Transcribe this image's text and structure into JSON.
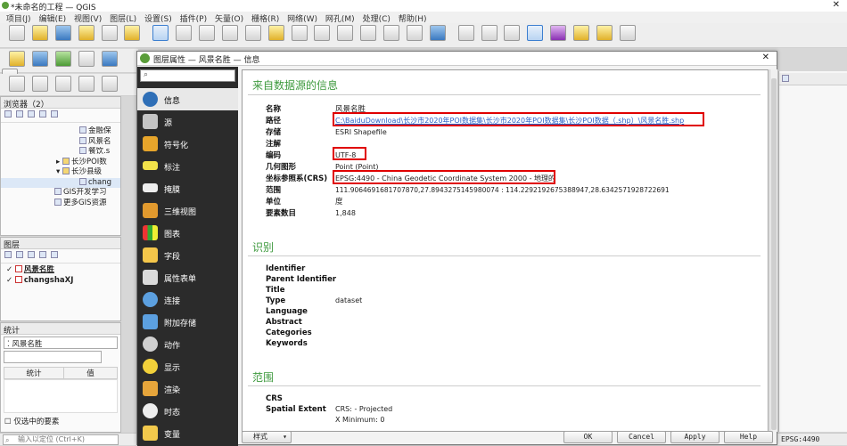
{
  "app": {
    "title": "*未命名的工程 — QGIS",
    "close": "✕"
  },
  "menu": [
    "项目(J)",
    "编辑(E)",
    "视图(V)",
    "图层(L)",
    "设置(S)",
    "插件(P)",
    "矢量(O)",
    "栅格(R)",
    "网络(W)",
    "网孔(M)",
    "处理(C)",
    "帮助(H)"
  ],
  "browser": {
    "title": "浏览器（2）",
    "items": [
      "金融保",
      "风景名",
      "餐饮.s",
      "长沙POI数",
      "长沙县级",
      "chang",
      "GIS开发学习",
      "更多GIS资源"
    ]
  },
  "layers": {
    "title": "图层",
    "items": [
      {
        "name": "风景名胜",
        "checked": "✓"
      },
      {
        "name": "changshaXJ",
        "checked": "✓"
      }
    ]
  },
  "stats": {
    "title": "统计",
    "layer": "风景名胜",
    "col_stat": "统计",
    "col_value": "值",
    "selected_only": "仅选中的要素",
    "locate_placeholder": "输入以定位 (Ctrl+K)"
  },
  "dialog": {
    "title": "图层属性 — 风景名胜 — 信息",
    "close": "✕",
    "nav": [
      "信息",
      "源",
      "符号化",
      "标注",
      "掩膜",
      "三维视图",
      "图表",
      "字段",
      "属性表单",
      "连接",
      "附加存储",
      "动作",
      "显示",
      "渲染",
      "时态",
      "变量"
    ],
    "style_label": "样式",
    "buttons": {
      "ok": "OK",
      "cancel": "Cancel",
      "apply": "Apply",
      "help": "Help"
    }
  },
  "info": {
    "section_source": "来自数据源的信息",
    "name_k": "名称",
    "name_v": "风景名胜",
    "path_k": "路径",
    "path_v": "C:\\BaiduDownload\\长沙市2020年POI数据集\\长沙市2020年POI数据集\\长沙POI数据（.shp）\\风景名胜.shp",
    "storage_k": "存储",
    "storage_v": "ESRI Shapefile",
    "comment_k": "注解",
    "comment_v": "",
    "encoding_k": "编码",
    "encoding_v": "UTF-8",
    "geometry_k": "几何图形",
    "geometry_v": "Point (Point)",
    "crs_k": "坐标参照系(CRS)",
    "crs_v": "EPSG:4490 - China Geodetic Coordinate System 2000 - 地理的",
    "extent_k": "范围",
    "extent_v": "111.9064691681707870,27.8943275145980074 : 114.2292192675388947,28.6342571928722691",
    "unit_k": "单位",
    "unit_v": "度",
    "count_k": "要素数目",
    "count_v": "1,848",
    "section_ident": "识别",
    "identifier_k": "Identifier",
    "parent_k": "Parent Identifier",
    "title_k": "Title",
    "type_k": "Type",
    "type_v": "dataset",
    "language_k": "Language",
    "abstract_k": "Abstract",
    "categories_k": "Categories",
    "keywords_k": "Keywords",
    "section_extent": "范围",
    "crs2_k": "CRS",
    "spatial_k": "Spatial Extent",
    "spatial_crs": "CRS: - Projected",
    "spatial_xmin": "X Minimum: 0"
  },
  "status": {
    "epsg": "EPSG:4490"
  }
}
